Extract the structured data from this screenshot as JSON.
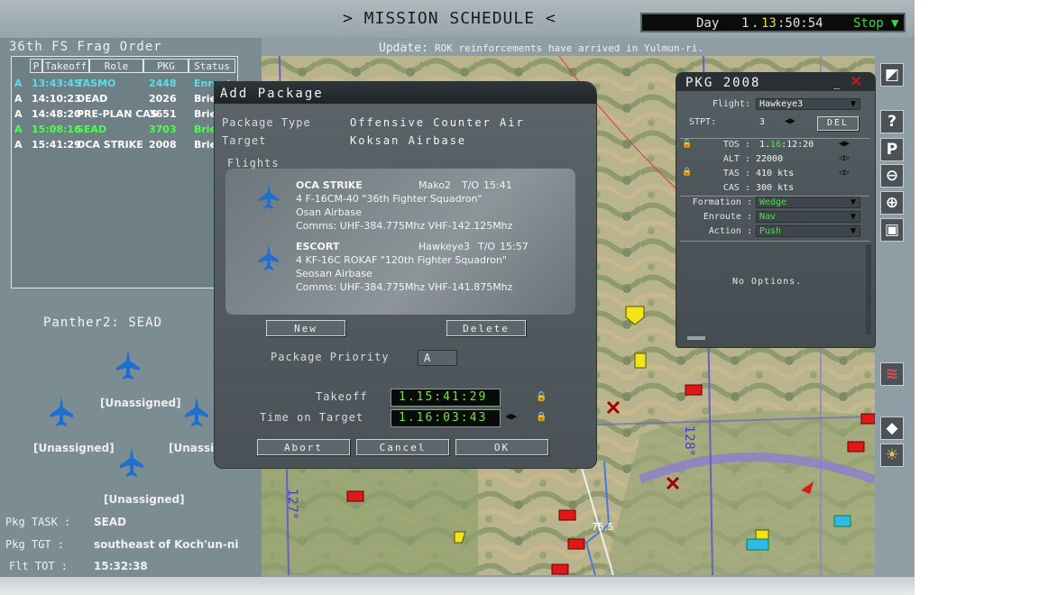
{
  "header": {
    "title": "> MISSION SCHEDULE <",
    "clock_day_label": "Day",
    "clock_day": "1",
    "clock_hh": "13",
    "clock_rest": ":50:54",
    "clock_state": "Stop"
  },
  "update": {
    "label": "Update:",
    "text": "ROK reinforcements have arrived in Yulmun-ri."
  },
  "frag_order": {
    "title": "36th FS Frag Order",
    "columns": [
      "P",
      "Takeoff",
      "Role",
      "PKG",
      "Status"
    ],
    "rows": [
      {
        "p": "A",
        "takeoff": "13:43:45",
        "role": "TASMO",
        "pkg": "2448",
        "status": "Enroute",
        "color": "#56e0ea"
      },
      {
        "p": "A",
        "takeoff": "14:10:23",
        "role": "DEAD",
        "pkg": "2026",
        "status": "Briefing",
        "color": "#ffffff"
      },
      {
        "p": "A",
        "takeoff": "14:48:20",
        "role": "PRE-PLAN CAS",
        "pkg": "3651",
        "status": "Briefing",
        "color": "#ffffff"
      },
      {
        "p": "A",
        "takeoff": "15:08:16",
        "role": "SEAD",
        "pkg": "3703",
        "status": "Briefing",
        "color": "#4cff4c"
      },
      {
        "p": "A",
        "takeoff": "15:41:29",
        "role": "OCA STRIKE",
        "pkg": "2008",
        "status": "Briefing",
        "color": "#ffffff"
      }
    ]
  },
  "flight": {
    "name": "Panther2: SEAD",
    "slots": [
      "[Unassigned]",
      "[Unassigned]",
      "[Unassigned]",
      "[Unassigned]"
    ]
  },
  "package_info": {
    "task_label": "Pkg TASK :",
    "task_value": "SEAD",
    "tgt_label": "Pkg TGT :",
    "tgt_value": "southeast of Koch'un-ni",
    "tot_label": "Flt TOT :",
    "tot_value": "15:32:38"
  },
  "add_package": {
    "title": "Add Package",
    "type_label": "Package Type",
    "type_value": "Offensive Counter Air",
    "target_label": "Target",
    "target_value": "Koksan Airbase",
    "flights_label": "Flights",
    "flights": [
      {
        "role": "OCA STRIKE",
        "callsign": "Mako2",
        "to_label": "T/O",
        "to": "15:41",
        "aircraft": "4 F-16CM-40 \"36th Fighter Squadron\"",
        "base": "Osan Airbase",
        "comms": "Comms: UHF-384.775Mhz VHF-142.125Mhz"
      },
      {
        "role": "ESCORT",
        "callsign": "Hawkeye3",
        "to_label": "T/O",
        "to": "15:57",
        "aircraft": "4 KF-16C ROKAF \"120th Fighter Squadron\"",
        "base": "Seosan Airbase",
        "comms": "Comms: UHF-384.775Mhz VHF-141.875Mhz"
      }
    ],
    "new_label": "New",
    "delete_label": "Delete",
    "priority_label": "Package Priority",
    "priority_value": "A",
    "takeoff_label": "Takeoff",
    "takeoff_value": "1.15:41:29",
    "tot_label": "Time on Target",
    "tot_value": "1.16:03:43",
    "abort_label": "Abort",
    "cancel_label": "Cancel",
    "ok_label": "OK"
  },
  "pkg_panel": {
    "title": "PKG 2008",
    "flight_label": "Flight:",
    "flight_value": "Hawkeye3",
    "stpt_label": "STPT:",
    "stpt_value": "3",
    "del_label": "DEL",
    "tos_label": "TOS :",
    "tos_prefix": "1.",
    "tos_hh": "16",
    "tos_rest": ":12:20",
    "alt_label": "ALT :",
    "alt_value": "22000",
    "tas_label": "TAS :",
    "tas_value": "410 kts",
    "cas_label": "CAS :",
    "cas_value": "300 kts",
    "formation_label": "Formation :",
    "formation_value": "Wedge",
    "enroute_label": "Enroute :",
    "enroute_value": "Nav",
    "action_label": "Action :",
    "action_value": "Push",
    "options_text": "No Options."
  },
  "map": {
    "grid_label_1": "128°",
    "grid_label_2": "127°",
    "airspeed_marker": "75.5"
  },
  "tools": [
    "?",
    "P"
  ],
  "colors": {
    "lcd_green": "#77e03a",
    "clock_yellow": "#e8d84a",
    "stop_green": "#3ed63e",
    "enemy_red": "#e01818",
    "friendly_blue": "#1f6fd0"
  }
}
